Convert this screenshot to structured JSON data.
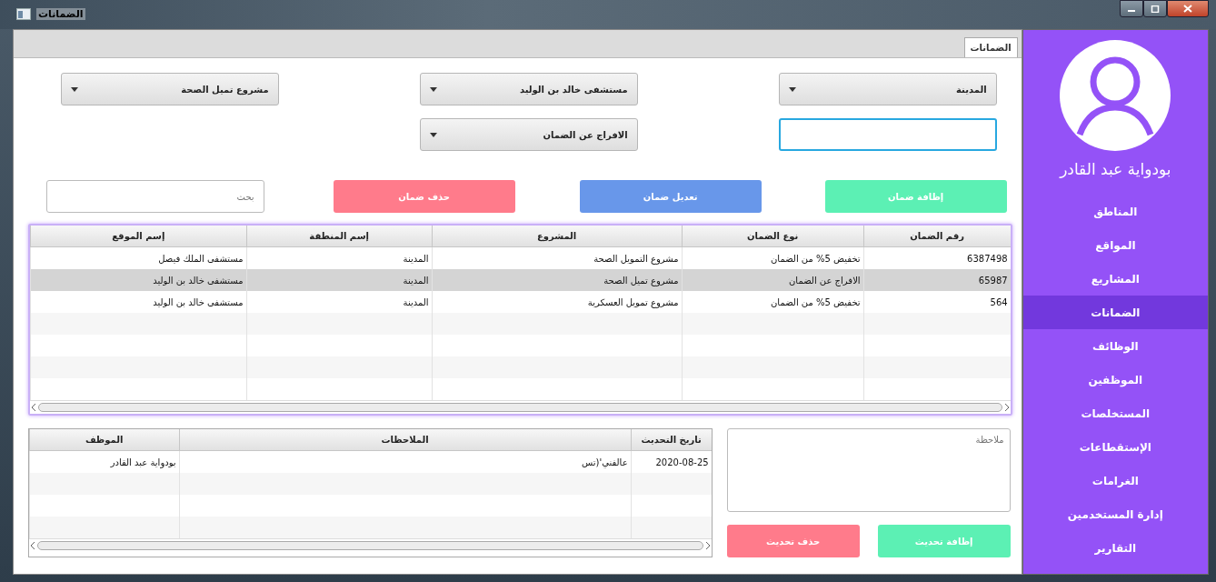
{
  "window": {
    "title": "الضمانات"
  },
  "tabs": [
    {
      "label": "الضمانات",
      "selected": true
    }
  ],
  "form": [
    {
      "kind": "combo",
      "value": "المدينة"
    },
    {
      "kind": "combo",
      "value": "مستشفى خالد بن الوليد"
    },
    {
      "kind": "combo",
      "value": "مشروع تميل الصحة"
    },
    {
      "kind": "text",
      "focused": true
    },
    {
      "kind": "combo",
      "value": "الافراج عن الضمان"
    }
  ],
  "actions": [
    {
      "kind": "add",
      "label": "إظافة ضمان"
    },
    {
      "kind": "edit",
      "label": "تعديل ضمان"
    },
    {
      "kind": "delete",
      "label": "حذف ضمان"
    }
  ],
  "search": {
    "placeholder": "بحث"
  },
  "guarantees_table": {
    "columns": [
      "رقم الضمان",
      "نوع الضمان",
      "المشروع",
      "إسم المنطقة",
      "إسم الموقع"
    ],
    "rows": [
      {
        "cells": [
          "6387498",
          "تخفيض 5% من الضمان",
          "مشروع التمويل الصحة",
          "المدينة",
          "مستشفى الملك فيصل"
        ],
        "selected": false
      },
      {
        "cells": [
          "65987",
          "الافراج عن الضمان",
          "مشروع تميل الصحة",
          "المدينة",
          "مستشفى خالد بن الوليد"
        ],
        "selected": true
      },
      {
        "cells": [
          "564",
          "تخفيض 5% من الضمان",
          "مشروع تمويل العسكرية",
          "المدينة",
          "مستشفى خالد بن الوليد"
        ],
        "selected": false
      }
    ]
  },
  "updates": {
    "note": {
      "placeholder": "ملاحظة"
    },
    "buttons": [
      {
        "kind": "add",
        "label": "إظافة تحديث"
      },
      {
        "kind": "delete",
        "label": "حذف تحديث"
      }
    ],
    "table": {
      "columns": [
        "تاريخ التحديث",
        "الملاحظات",
        "الموظف"
      ],
      "rows": [
        {
          "cells": [
            "2020-08-25",
            "عالفني'(تس",
            "بودواية عبد القادر"
          ]
        }
      ]
    }
  },
  "sidebar": {
    "user": "بودواية عبد القادر",
    "items": [
      {
        "label": "المناطق",
        "selected": false
      },
      {
        "label": "المواقع",
        "selected": false
      },
      {
        "label": "المشاريع",
        "selected": false
      },
      {
        "label": "الضمانات",
        "selected": true
      },
      {
        "label": "الوظائف",
        "selected": false
      },
      {
        "label": "الموظفين",
        "selected": false
      },
      {
        "label": "المستخلصات",
        "selected": false
      },
      {
        "label": "الإستقطاعات",
        "selected": false
      },
      {
        "label": "الغرامات",
        "selected": false
      },
      {
        "label": "إدارة المستخدمين",
        "selected": false
      },
      {
        "label": "التقارير",
        "selected": false
      }
    ]
  }
}
